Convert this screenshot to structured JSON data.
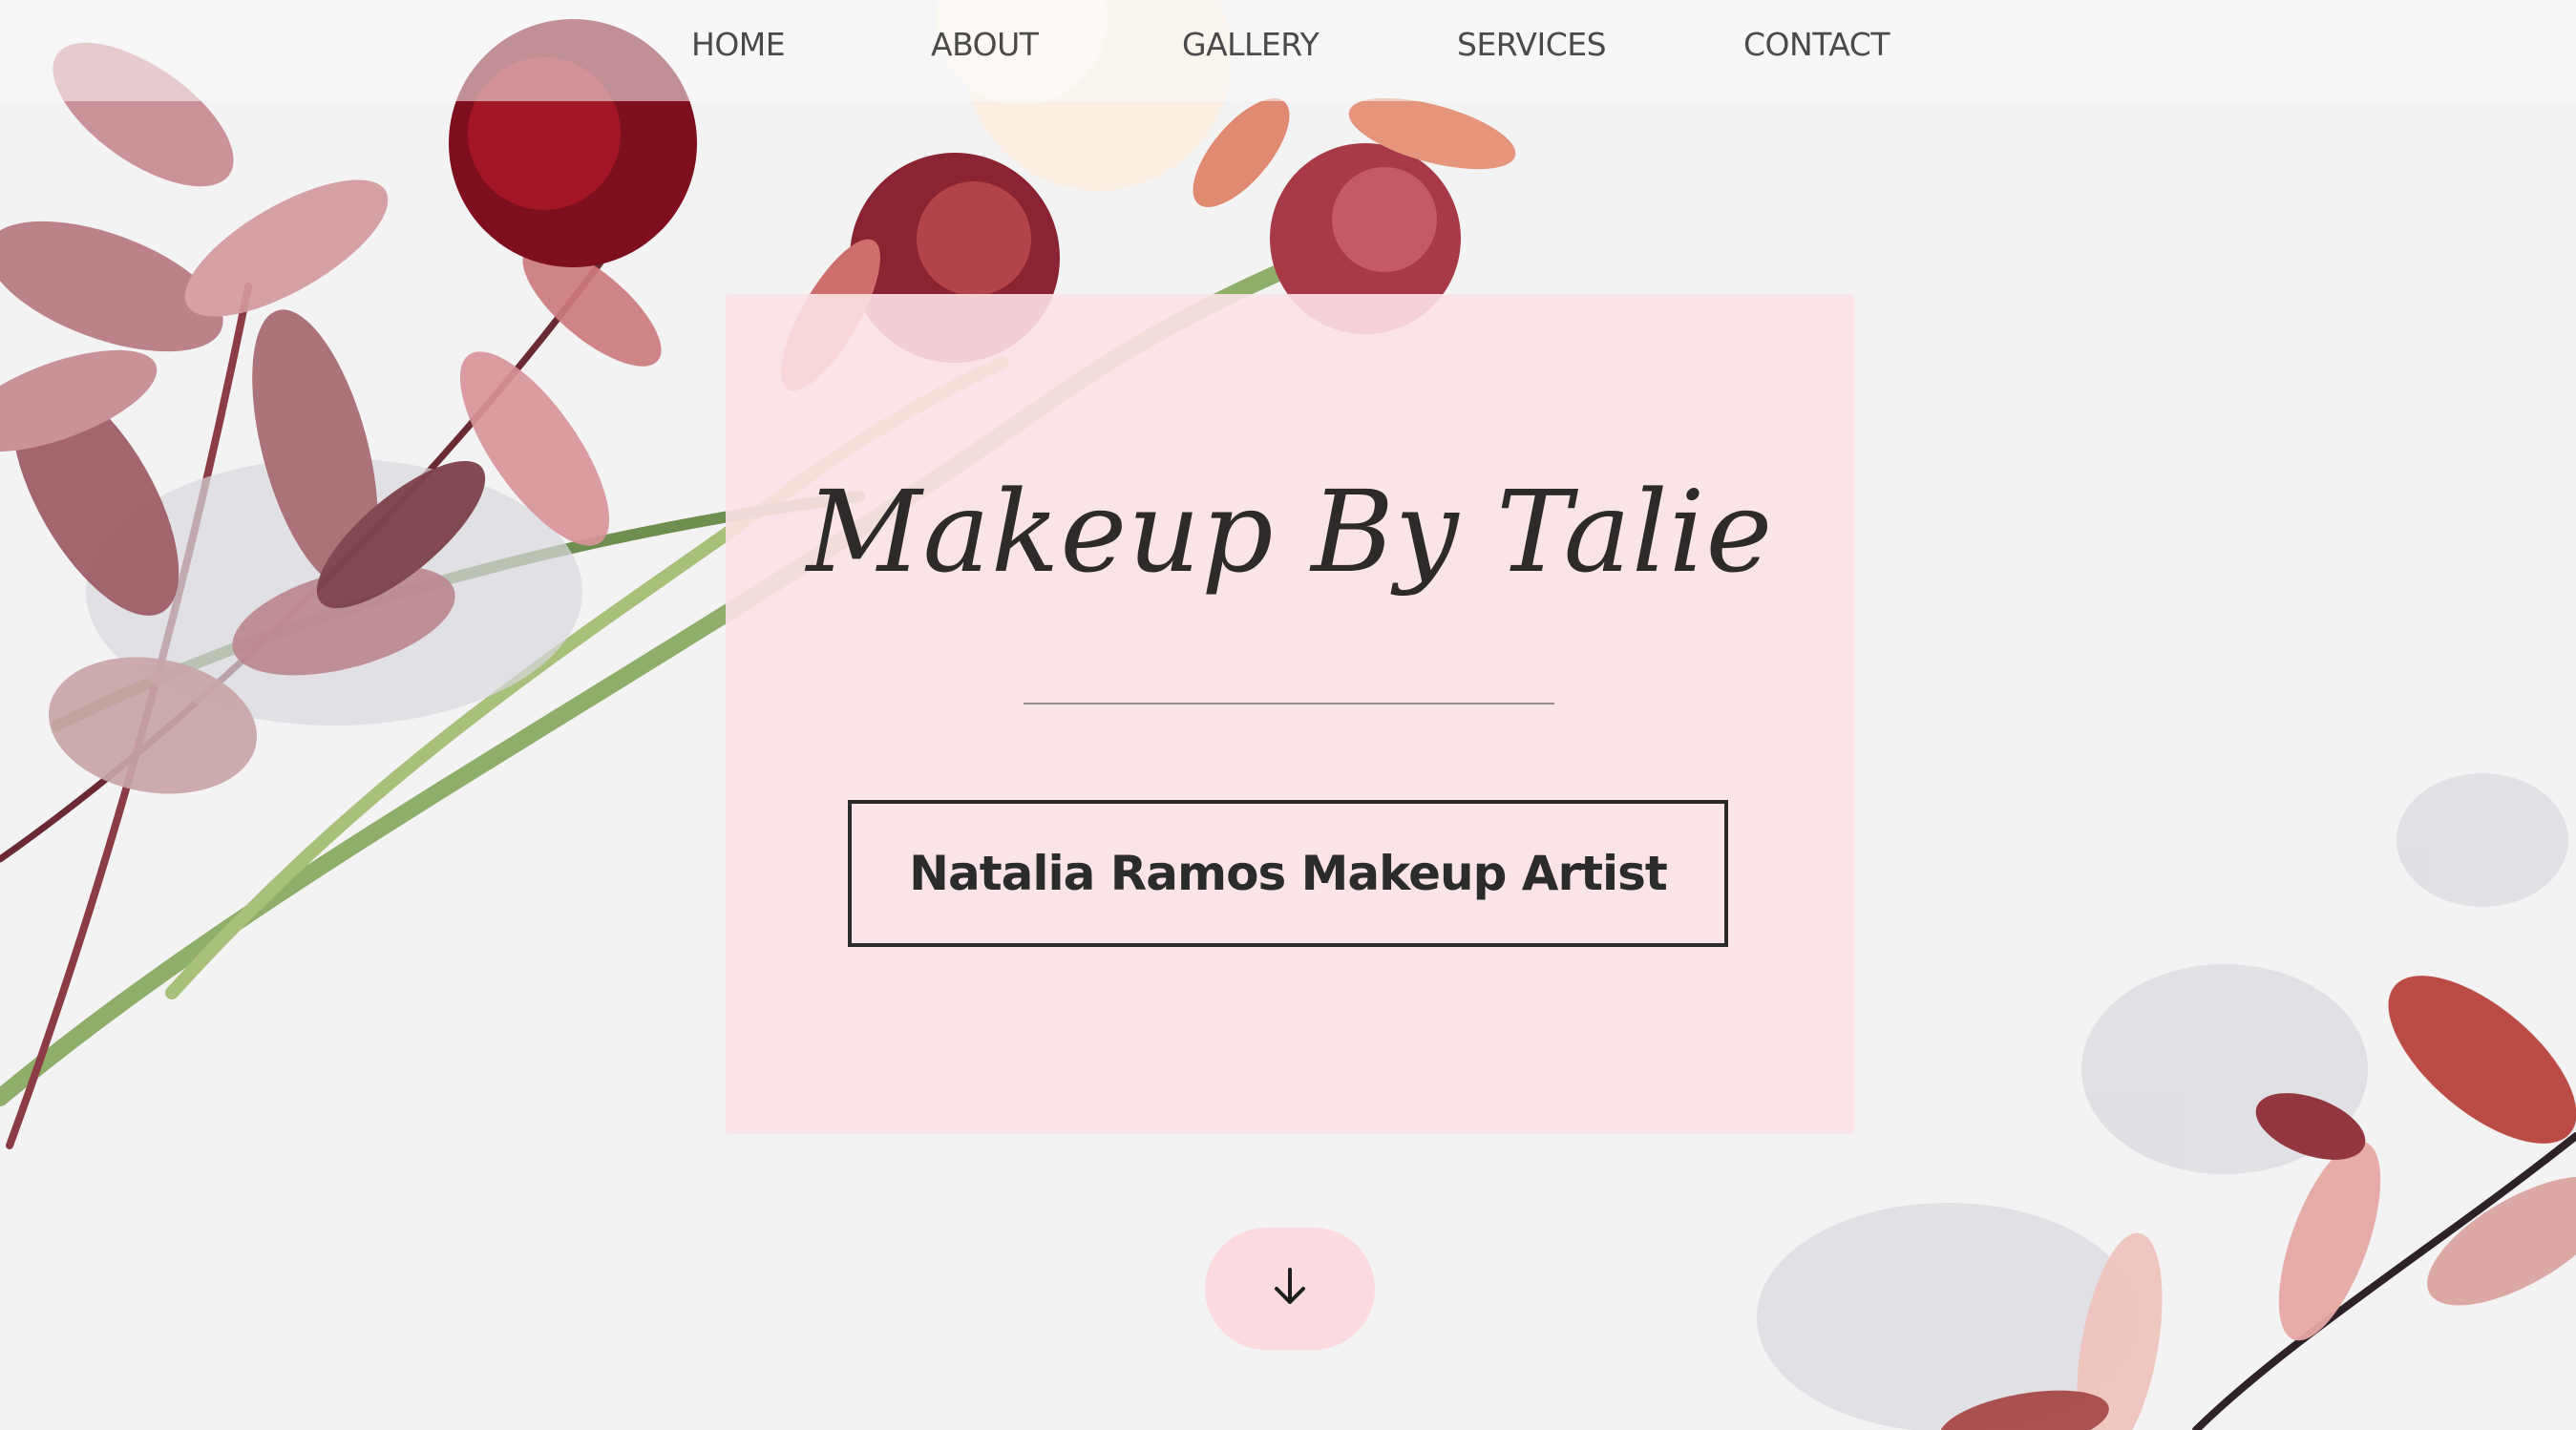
{
  "nav": {
    "items": [
      {
        "label": "HOME"
      },
      {
        "label": "ABOUT"
      },
      {
        "label": "GALLERY"
      },
      {
        "label": "SERVICES"
      },
      {
        "label": "CONTACT"
      }
    ]
  },
  "hero": {
    "brand": "Makeup By Talie",
    "tagline": "Natalia Ramos Makeup Artist"
  },
  "scroll": {
    "icon": "arrow-down-icon"
  },
  "colors": {
    "card": "#fce2e5",
    "text": "#2b2b2b",
    "accent": "#fbd9dd"
  }
}
